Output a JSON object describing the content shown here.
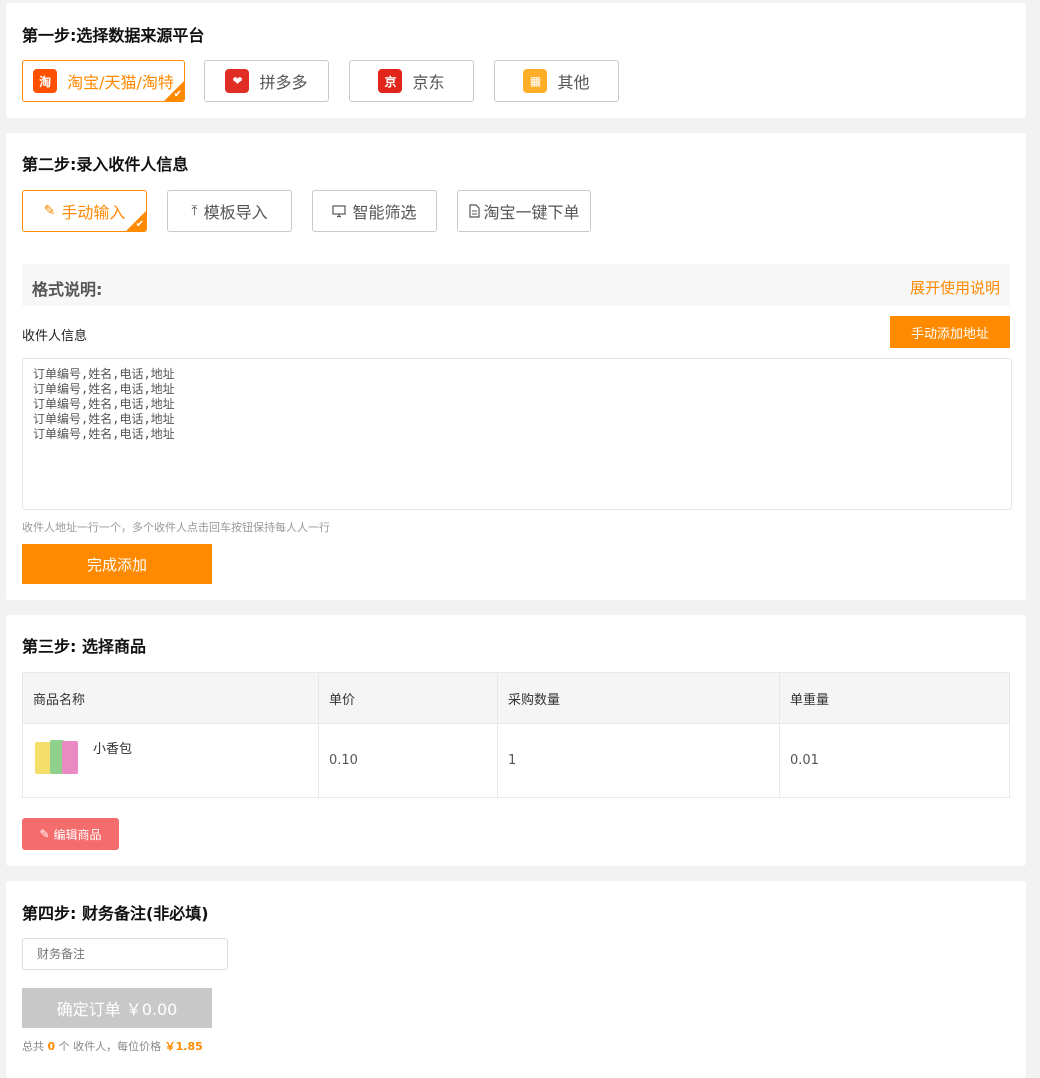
{
  "step1": {
    "title": "第一步:选择数据来源平台",
    "platforms": [
      {
        "label": "淘宝/天猫/淘特",
        "icon_char": "淘",
        "icon_color": "#ff5000"
      },
      {
        "label": "拼多多",
        "icon_char": "❤",
        "icon_color": "#e02e24"
      },
      {
        "label": "京东",
        "icon_char": "京",
        "icon_color": "#e1251b"
      },
      {
        "label": "其他",
        "icon_char": "▦",
        "icon_color": "#ffae27"
      }
    ],
    "selected_index": 0
  },
  "step2": {
    "title": "第二步:录入收件人信息",
    "methods": [
      {
        "label": "手动输入",
        "icon": "pencil-icon"
      },
      {
        "label": "模板导入",
        "icon": "upload-icon"
      },
      {
        "label": "智能筛选",
        "icon": "monitor-icon"
      },
      {
        "label": "淘宝一键下单",
        "icon": "document-icon"
      }
    ],
    "selected_index": 0,
    "format_title": "格式说明:",
    "expand_link": "展开使用说明",
    "recipient_label": "收件人信息",
    "manual_add_button": "手动添加地址",
    "textarea_value": "订单编号,姓名,电话,地址\n订单编号,姓名,电话,地址\n订单编号,姓名,电话,地址\n订单编号,姓名,电话,地址\n订单编号,姓名,电话,地址",
    "hint": "收件人地址一行一个，多个收件人点击回车按钮保持每人人一行",
    "complete_button": "完成添加"
  },
  "step3": {
    "title": "第三步: 选择商品",
    "columns": [
      "商品名称",
      "单价",
      "采购数量",
      "单重量"
    ],
    "rows": [
      {
        "name": "小香包",
        "price": "0.10",
        "qty": "1",
        "weight": "0.01"
      }
    ],
    "edit_button": "编辑商品"
  },
  "step4": {
    "title": "第四步: 财务备注(非必填)",
    "remark_placeholder": "财务备注",
    "confirm_button": "确定订单 ￥0.00",
    "summary_prefix": "总共",
    "summary_count": "0",
    "summary_middle": "个 收件人，每位价格",
    "summary_price": "￥1.85"
  },
  "colors": {
    "accent": "#ff8a00",
    "danger": "#f56c6c",
    "disabled": "#c8c8c8"
  }
}
